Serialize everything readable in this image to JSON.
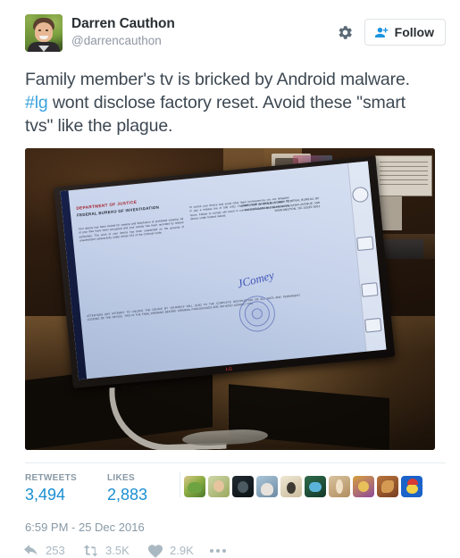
{
  "tweet": {
    "author": {
      "display_name": "Darren Cauthon",
      "screen_name": "@darrencauthon",
      "avatar_alt": "profile-photo"
    },
    "header": {
      "gear_icon": "gear-icon",
      "follow_label": "Follow",
      "follow_icon": "person-add-icon"
    },
    "text": {
      "part1": "Family member's tv is bricked by Android malware. ",
      "hashtag": "#lg",
      "part2": " wont disclose factory reset. Avoid these \"smart tvs\" like the plague."
    },
    "photo": {
      "alt": "lg-smart-tv-showing-fbi-ransomware-lockscreen",
      "screen": {
        "heading": "DEPARTMENT OF JUSTICE",
        "subheading": "FEDERAL BUREAU OF INVESTIGATION",
        "body_left": "Your device has been locked for viewing and distribution of prohibited material. All of your files have been encrypted and your activity has been recorded by federal authorities. The work of your device has been suspended on the grounds of unauthorized cyberactivity under Article 161 of the Criminal Code.",
        "body_mid": "To unlock your device and avoid other legal consequences you are obligated to pay a release fee of 500 USD. Payment must be completed within 72 hours. Failure to comply will result in criminal prosecution and seizure of the device under federal statute.",
        "body_bottom": "ATTENTION! ANY ATTEMPT TO UNLOCK THE DEVICE BY YOURSELF WILL LEAD TO THE COMPLETE DESTRUCTION OF ALL DATA AND PERMANENT LOCKING OF THE DEVICE. THIS IS THE FINAL WARNING BEFORE CRIMINAL PROCEEDINGS ARE INITIATED AGAINST YOU.",
        "address": "DIRECTOR JAMES B. COMEY FEDERAL BUREAU OF INVESTIGATION 935 PENNSYLVANIA AVENUE, NW WASHINGTON, DC 20535-0001",
        "signature": "JComey",
        "seal": "fbi-seal",
        "tv_brand": "LG"
      }
    },
    "stats": {
      "retweets_label": "RETWEETS",
      "retweets_value": "3,494",
      "likes_label": "LIKES",
      "likes_value": "2,883",
      "facepile_count": 10
    },
    "timestamp": "6:59 PM - 25 Dec 2016",
    "actions": {
      "reply_icon": "reply-arrow-icon",
      "reply_count": "253",
      "retweet_icon": "retweet-icon",
      "retweet_count": "3.5K",
      "like_icon": "heart-icon",
      "like_count": "2.9K",
      "more_icon": "more-dots-icon"
    }
  },
  "colors": {
    "twitter_blue": "#1b8ed1",
    "link_blue": "#3ba3dd",
    "text_dark": "#3d4852",
    "muted": "#8899a6",
    "action_gray": "#aab8c2",
    "border": "#e6ecf0"
  }
}
